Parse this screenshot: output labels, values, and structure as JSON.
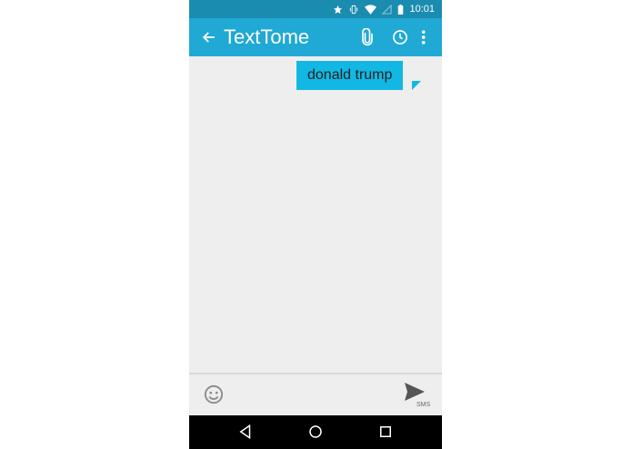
{
  "status_bar": {
    "time": "10:01",
    "icons": [
      "star-icon",
      "vibrate-icon",
      "wifi-icon",
      "signal-icon",
      "battery-icon"
    ]
  },
  "app_bar": {
    "title": "TextTome",
    "actions": [
      "attach-icon",
      "schedule-icon",
      "more-icon"
    ]
  },
  "messages": [
    {
      "text": "donald trump",
      "direction": "sent"
    }
  ],
  "compose": {
    "input_value": "",
    "send_sublabel": "SMS"
  },
  "nav": [
    "back-icon",
    "home-icon",
    "recents-icon"
  ],
  "colors": {
    "status_bar": "#1a8cb0",
    "app_bar": "#20a9d4",
    "bubble": "#12b8e3",
    "background": "#eeeeee"
  }
}
